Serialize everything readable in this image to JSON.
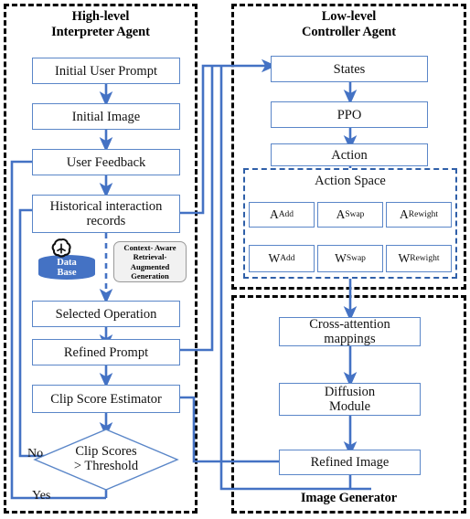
{
  "diagram": {
    "title": "Interactive image generation agent framework",
    "accent_blue": "#4472c4",
    "box_border": "#5a86c8",
    "panel_border": "#000000"
  },
  "panels": {
    "interpreter": {
      "title": "High-level\nInterpreter Agent"
    },
    "controller": {
      "title": "Low-level\nController Agent"
    },
    "generator": {
      "title": "Image Generator"
    }
  },
  "interpreter_nodes": {
    "initial_user_prompt": "Initial User Prompt",
    "initial_image": "Initial Image",
    "user_feedback": "User Feedback",
    "historical_records": "Historical interaction\nrecords",
    "selected_operation": "Selected Operation",
    "refined_prompt": "Refined Prompt",
    "clip_score_estimator": "Clip Score Estimator",
    "decision": "Clip Scores\n> Threshold",
    "decision_no": "No",
    "decision_yes": "Yes",
    "database": "Data\nBase",
    "rag_note": "Context- Aware\nRetrieval-\nAugmented\nGeneration",
    "openai_icon": "openai-logo-icon"
  },
  "controller_nodes": {
    "states": "States",
    "ppo": "PPO",
    "action": "Action",
    "action_space_label": "Action Space",
    "actions": [
      {
        "base": "A",
        "sub": "Add"
      },
      {
        "base": "A",
        "sub": "Swap"
      },
      {
        "base": "A",
        "sub": "Rewight"
      }
    ],
    "weights": [
      {
        "base": "W",
        "sub": "Add"
      },
      {
        "base": "W",
        "sub": "Swap"
      },
      {
        "base": "W",
        "sub": "Rewight"
      }
    ]
  },
  "generator_nodes": {
    "cross_attention": "Cross-attention\nmappings",
    "diffusion_module": "Diffusion\nModule",
    "refined_image": "Refined Image"
  }
}
